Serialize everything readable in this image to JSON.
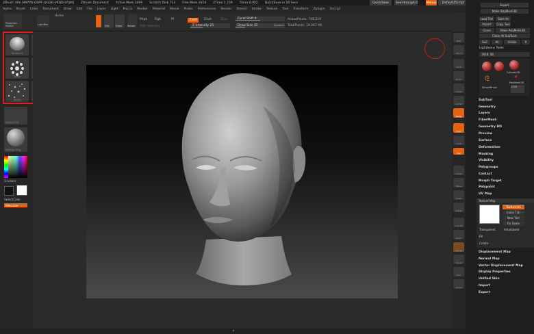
{
  "title_bar": {
    "app_title": "ZBrush 4R6 [WRVW-QOPF-QGDQ-VKQD-HYJW]",
    "document": "ZBrush Document",
    "active_mem": "Active Mem 1099",
    "scratch_disk": "Scratch Disk 713",
    "free_mem": "Free Mem 2014",
    "ztime": "ZTime 1.239",
    "timer": "Timer 0.002",
    "quicksave_note": "QuickSave in 50 Secs",
    "quicksave_label": "QuickSave",
    "see_through_label": "See-through",
    "see_through_value": "0",
    "menus_label": "Menus",
    "default_zscript": "DefaultZScript"
  },
  "menu_bar": [
    "Alpha",
    "Brush",
    "Color",
    "Document",
    "Draw",
    "Edit",
    "File",
    "Layer",
    "Light",
    "Macro",
    "Marker",
    "Material",
    "Movie",
    "Picker",
    "Preferences",
    "Render",
    "Stencil",
    "Stroke",
    "Texture",
    "Tool",
    "Transform",
    "Zplugin",
    "Zscript"
  ],
  "shelf": {
    "projection_master": "Projection Master",
    "lightbox": "LightBox",
    "preview_label": "Pr",
    "home_label": "Home",
    "edit_label": "Edit",
    "draw_label": "Draw",
    "move_label": "Move",
    "scale_label": "Scale",
    "rotate_label": "Rotate",
    "mrgb_label": "Mrgb",
    "rgb_label": "Rgb",
    "m_label": "M",
    "rgb_intensity": "Rgb Intensity",
    "zadd_label": "Zadd",
    "zsub_label": "Zsub",
    "zcut_label": "Zcut",
    "z_intensity": "Z Intensity 25",
    "focal_shift": "Focal Shift 0",
    "draw_size": "Draw Size 35",
    "dynamic_label": "Dynamic",
    "active_points": "ActivePoints: 748,224",
    "total_points": "TotalPoints: 19.067 Mil"
  },
  "left_panel": {
    "brushes": [
      "Standard",
      "ClayBuildup",
      "Spray",
      "DragDot",
      "Alpha",
      "Stroke",
      "Texture",
      "Alpha Off"
    ],
    "texture_off_label": "Texture Off",
    "material_label": "MatCap Gray",
    "gradient_label": "Gradient",
    "switch_color_label": "SwitchColor",
    "alternate_label": "Alternate"
  },
  "right_strip": [
    "BPR",
    "SPix 3",
    "Scroll",
    "Zoom",
    "Actual",
    "AAHalf",
    "Persp",
    "Floor",
    "Local",
    "L.Sym",
    "Xyz",
    "Frame",
    "Move",
    "Scale",
    "Rotate",
    "Line Fill",
    "PolyF",
    "Transp",
    "Ghost",
    "Solo",
    "Xpose"
  ],
  "right_tray": {
    "top_buttons": [
      "Export",
      "Make PolyMesh3D",
      "GoZ",
      "All",
      "Visible",
      "R",
      "Clone",
      "Make PolyMesh3D",
      "Clone All SubTools",
      "Load Tool",
      "Save As",
      "Copy Tool",
      "Import"
    ],
    "lightbox_tools": "Lightbox ▸ Tools",
    "tool_name": "1928. 48",
    "tool_thumbs": [
      "Cylinder3D",
      "PolyMesh3D",
      "SimpleBrush",
      "1928"
    ],
    "subtool_menus": [
      "SubTool",
      "Geometry",
      "Layers",
      "FiberMesh",
      "Geometry HD",
      "Preview",
      "Surface",
      "Deformation",
      "Masking",
      "Visibility",
      "Polygroups",
      "Contact",
      "Morph Target",
      "Polypaint",
      "UV Map"
    ],
    "texture_map": {
      "header": "Texture Map",
      "texture_on": "Texture On",
      "clone_txtr": "Clone Txtr",
      "new_txtr": "New Txtr",
      "fix_seam": "Fix Seam",
      "transparent": "Transparent",
      "antialiased": "Antialiased",
      "fill": "Fill",
      "create": "Create"
    },
    "bottom_menus": [
      "Displacement Map",
      "Normal Map",
      "Vector Displacement Map",
      "Display Properties",
      "Unified Skin",
      "Import",
      "Export"
    ]
  }
}
